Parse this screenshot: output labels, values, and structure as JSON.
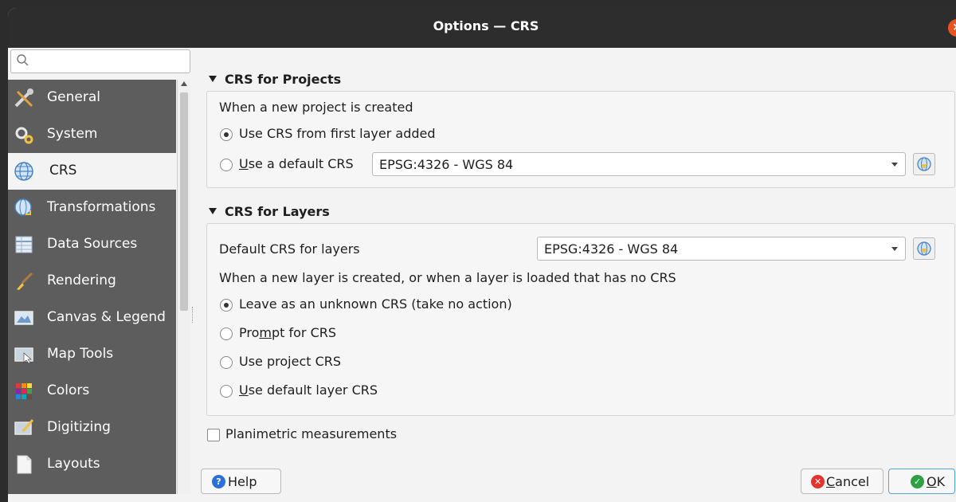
{
  "window": {
    "title": "Options — CRS",
    "close_glyph": "×"
  },
  "sidebar": {
    "search_placeholder": "",
    "items": [
      {
        "label": "General",
        "icon": "tools-icon"
      },
      {
        "label": "System",
        "icon": "system-gears-icon"
      },
      {
        "label": "CRS",
        "icon": "globe-icon",
        "selected": true
      },
      {
        "label": "Transformations",
        "icon": "transformations-globe-icon"
      },
      {
        "label": "Data Sources",
        "icon": "table-icon"
      },
      {
        "label": "Rendering",
        "icon": "paintbrush-icon"
      },
      {
        "label": "Canvas & Legend",
        "icon": "canvas-icon"
      },
      {
        "label": "Map Tools",
        "icon": "map-tools-icon"
      },
      {
        "label": "Colors",
        "icon": "color-grid-icon"
      },
      {
        "label": "Digitizing",
        "icon": "digitizing-icon"
      },
      {
        "label": "Layouts",
        "icon": "layouts-icon"
      }
    ]
  },
  "projects": {
    "header": "CRS for Projects",
    "prompt": "When a new project is created",
    "option_first_layer": "Use CRS from first layer added",
    "option_default_u": "U",
    "option_default_rest": "se a default CRS",
    "crs_value": "EPSG:4326 - WGS 84",
    "selected_option": "first_layer"
  },
  "layers": {
    "header": "CRS for Layers",
    "default_label": "Default CRS for layers",
    "crs_value": "EPSG:4326 - WGS 84",
    "prompt": "When a new layer is created, or when a layer is loaded that has no CRS",
    "option_unknown": "Leave as an unknown CRS (take no action)",
    "option_prompt_a": "Pro",
    "option_prompt_u": "m",
    "option_prompt_b": "pt for CRS",
    "option_project": "Use project CRS",
    "option_default_u": "U",
    "option_default_rest": "se default layer CRS",
    "selected_option": "unknown"
  },
  "planimetric": {
    "label": "Planimetric measurements",
    "checked": false
  },
  "buttons": {
    "help": "Help",
    "cancel_u": "C",
    "cancel_rest": "ancel",
    "ok_u": "O",
    "ok_rest": "K"
  },
  "colors": {
    "accent": "#e95420",
    "ok": "#2ea043",
    "cancel": "#e5322d",
    "help": "#2a6fdb",
    "sidebar_bg": "#5d5d5d"
  }
}
